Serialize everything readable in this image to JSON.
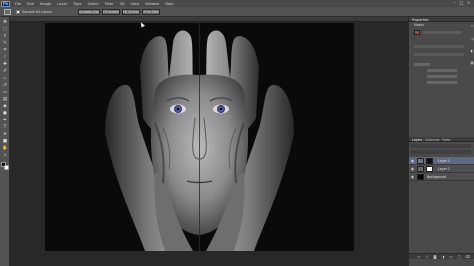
{
  "app": {
    "logo_text": "Ps"
  },
  "menubar": {
    "items": [
      "File",
      "Edit",
      "Image",
      "Layer",
      "Type",
      "Select",
      "Filter",
      "3D",
      "View",
      "Window",
      "Help"
    ]
  },
  "options_bar": {
    "checkbox_label": "Sample All Layers",
    "buttons": [
      "Scrubby Zoom",
      "Fit Screen",
      "Fill Screen",
      "Print Size"
    ]
  },
  "properties_panel": {
    "title": "Properties",
    "subtitle": "Masks"
  },
  "layers_panel": {
    "tabs": [
      "Layers",
      "Channels",
      "Paths"
    ],
    "layers": [
      {
        "name": "Layer 1",
        "selected": true
      },
      {
        "name": "Layer 1",
        "selected": false
      },
      {
        "name": "Background",
        "selected": false
      }
    ]
  },
  "colors": {
    "accent_selection": "#5a6a85",
    "mask_indicator": "#c03a4a",
    "eye_tint": "#5b6fd4"
  },
  "icons": [
    "zoom-tool-icon",
    "move-icon",
    "marquee-icon",
    "lasso-icon",
    "quick-select-icon",
    "crop-icon",
    "eyedropper-icon",
    "healing-brush-icon",
    "brush-icon",
    "clone-stamp-icon",
    "history-brush-icon",
    "eraser-icon",
    "gradient-icon",
    "blur-icon",
    "dodge-icon",
    "pen-icon",
    "type-icon",
    "path-select-icon",
    "shape-icon",
    "hand-icon",
    "zoom-icon",
    "eye-icon",
    "link-icon"
  ]
}
